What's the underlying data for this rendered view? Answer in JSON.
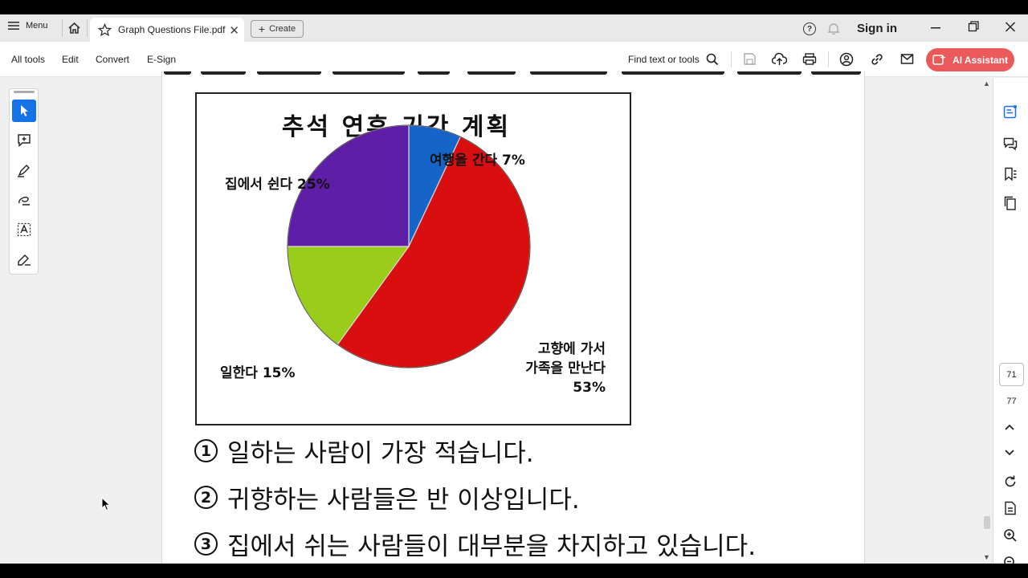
{
  "titlebar": {
    "menu_label": "Menu",
    "tab_title": "Graph Questions File.pdf",
    "create_label": "Create",
    "help_glyph": "?",
    "sign_in": "Sign in"
  },
  "toolbar": {
    "items": [
      "All tools",
      "Edit",
      "Convert",
      "E-Sign"
    ],
    "find_label": "Find text or tools",
    "ai_assistant": "AI Assistant",
    "accent_color": "#eb5a5a"
  },
  "left_tools": [
    "select-arrow-icon",
    "add-comment-icon",
    "highlight-pen-icon",
    "draw-freehand-icon",
    "text-recognition-icon",
    "sign-pen-icon"
  ],
  "document": {
    "chart_title": "추석 연휴 기간 계획",
    "questions": [
      {
        "num": "1",
        "text": "일하는 사람이 가장 적습니다."
      },
      {
        "num": "2",
        "text": "귀향하는 사람들은 반 이상입니다."
      },
      {
        "num": "3",
        "text": "집에서 쉬는 사람들이 대부분을 차지하고 있습니다."
      }
    ]
  },
  "chart_data": {
    "type": "pie",
    "title": "추석 연휴 기간 계획",
    "slices": [
      {
        "label": "여행을 간다 7%",
        "value": 7,
        "color": "#1565c8"
      },
      {
        "label": "고향에 가서 가족을 만난다 53%",
        "label_lines": [
          "고향에 가서",
          "가족을 만난다",
          "53%"
        ],
        "value": 53,
        "color": "#d90f0f"
      },
      {
        "label": "일한다 15%",
        "value": 15,
        "color": "#9acd1a"
      },
      {
        "label": "집에서 쉰다 25%",
        "value": 25,
        "color": "#5f1ea8"
      }
    ]
  },
  "navigation": {
    "current_page": "71",
    "total_pages": "77"
  }
}
